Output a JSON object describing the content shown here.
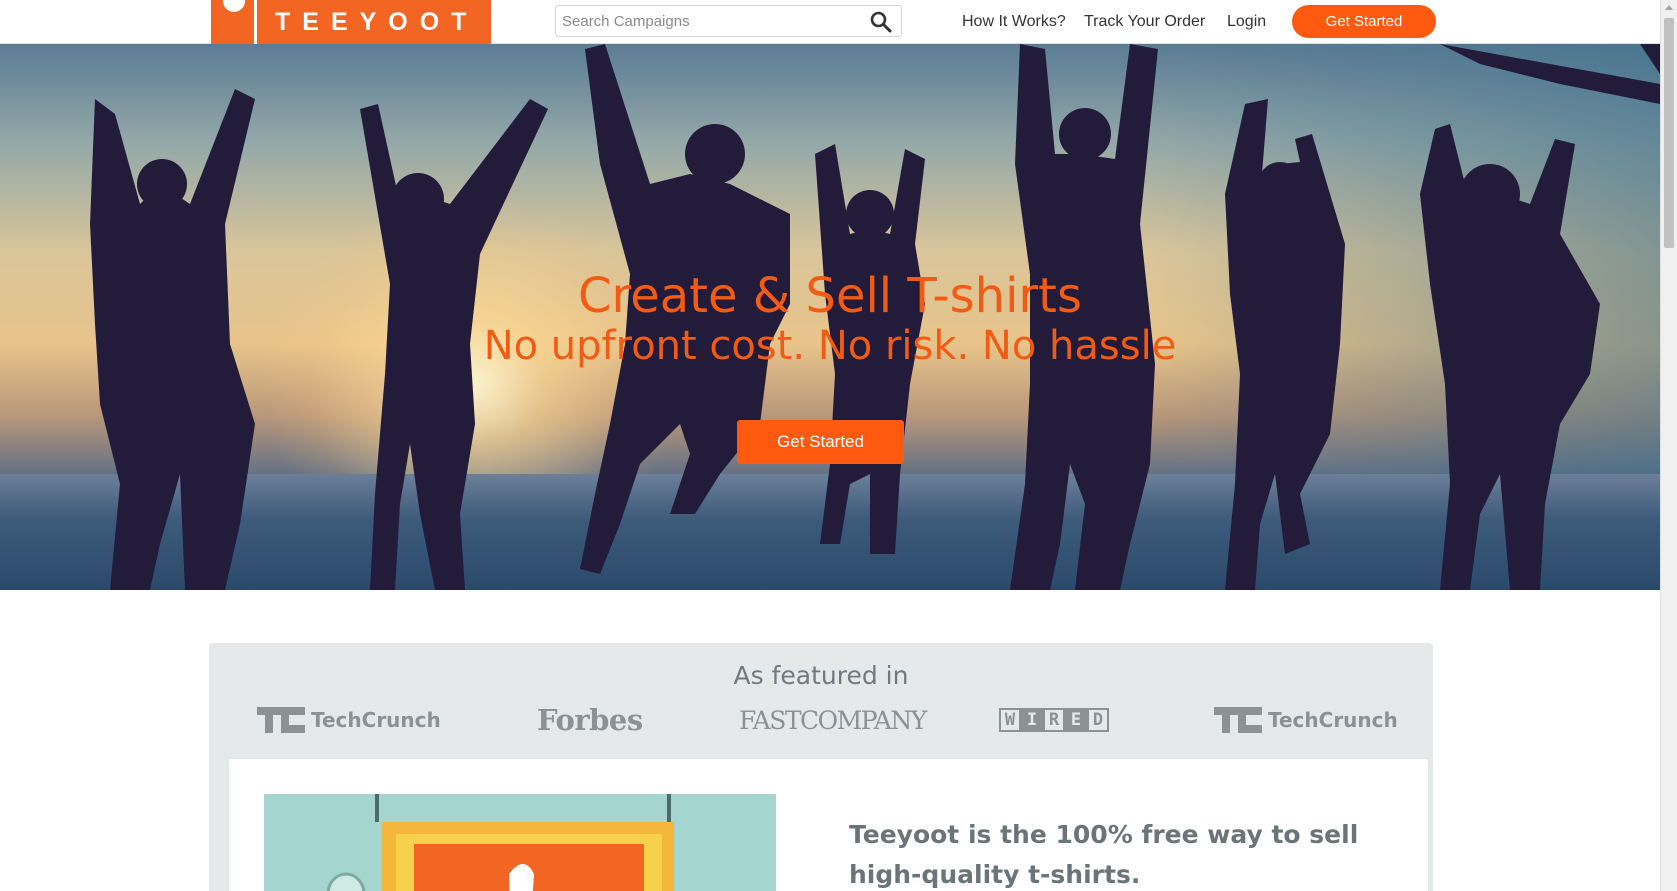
{
  "header": {
    "logo_text": "TEEYOOT",
    "search_placeholder": "Search Campaigns",
    "nav": {
      "how_it_works": "How It Works?",
      "track_order": "Track Your Order",
      "login": "Login"
    },
    "cta_label": "Get Started"
  },
  "hero": {
    "title": "Create & Sell T-shirts",
    "subtitle": "No upfront cost. No risk. No hassle",
    "cta_label": "Get Started"
  },
  "featured": {
    "title": "As featured in",
    "logos": {
      "techcrunch_1": "TechCrunch",
      "forbes": "Forbes",
      "fast_company": "FASTCOMPANY",
      "wired": [
        "W",
        "I",
        "R",
        "E",
        "D"
      ],
      "techcrunch_2": "TechCrunch"
    }
  },
  "about": {
    "text": "Teeyoot is the 100% free way to sell high-quality t-shirts."
  },
  "colors": {
    "brand_orange": "#f26522",
    "button_orange": "#ff5a0f",
    "featured_bg": "#e6e9e9",
    "press_gray": "#8c9294"
  },
  "icons": {
    "search": "search-icon",
    "logo": "teeyoot-logo-icon"
  }
}
